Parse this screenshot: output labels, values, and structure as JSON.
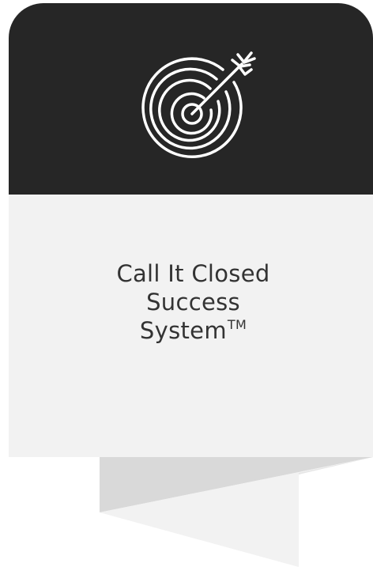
{
  "card": {
    "header_icon": "target-with-arrow-icon",
    "header_color": "#262626",
    "body_color": "#f2f2f2",
    "title_lines": [
      "Call It Closed",
      "Success",
      "System"
    ],
    "trademark": "TM"
  },
  "ribbon": {
    "colors": [
      "#d9d9d9",
      "#f2f2f2"
    ]
  }
}
